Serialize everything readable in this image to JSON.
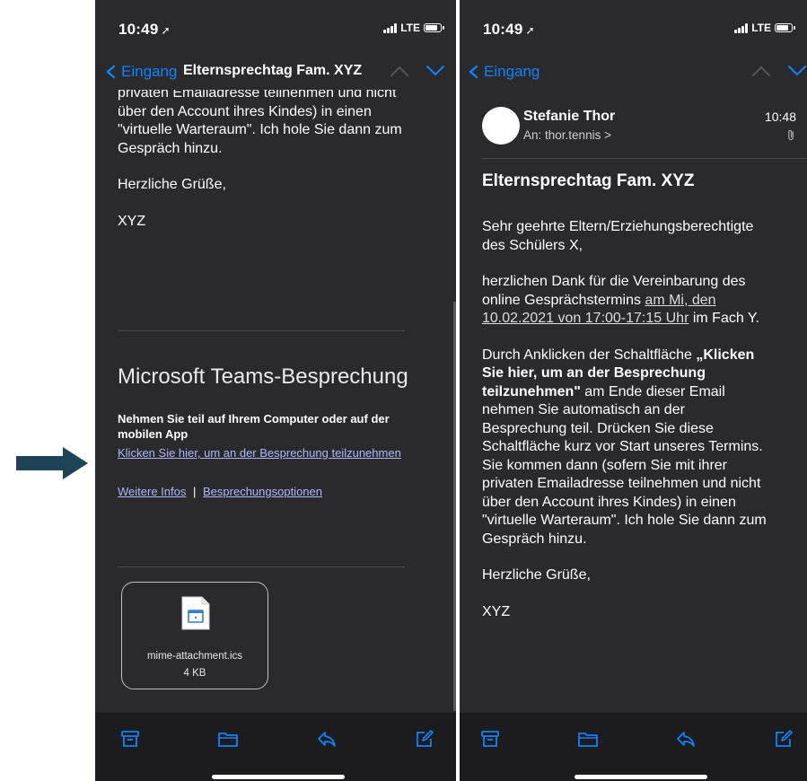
{
  "colors": {
    "accent": "#0a84ff",
    "background": "#2a2a2c",
    "toolbar": "#1c1c1e",
    "arrow": "#1f4458"
  },
  "status_bar": {
    "time": "10:49",
    "network": "LTE"
  },
  "left": {
    "back_label": "Eingang",
    "title": "Elternsprechtag Fam. XYZ",
    "body_lines": [
      "privaten Emailadresse teilnehmen und nicht",
      "über den Account ihres Kindes) in einen",
      "\"virtuelle Warteraum\". Ich hole Sie dann zum",
      "Gespräch hinzu."
    ],
    "greeting": "Herzliche Grüße,",
    "signature": "XYZ",
    "teams": {
      "heading": "Microsoft Teams-Besprechung",
      "join_text_1": "Nehmen Sie teil auf Ihrem Computer oder auf der",
      "join_text_2": "mobilen App",
      "join_link": "Klicken Sie hier, um an der Besprechung teilzunehmen",
      "more_info": "Weitere Infos",
      "divider": "|",
      "options": "Besprechungsoptionen"
    },
    "attachment": {
      "name": "mime-attachment.ics",
      "size": "4 KB"
    }
  },
  "right": {
    "back_label": "Eingang",
    "sender": "Stefanie Thor",
    "to_label": "An:",
    "recipient": "thor.tennis >",
    "time": "10:48",
    "subject": "Elternsprechtag Fam. XYZ",
    "salutation": [
      "Sehr geehrte Eltern/Erziehungsberechtigte",
      "des Schülers X,"
    ],
    "para2_lines": [
      "herzlichen Dank für die Vereinbarung des"
    ],
    "para2_line2_pre": "online Gesprächstermins ",
    "para2_line2_link": "am Mi, den",
    "para2_line3_link": "10.02.2021 von 17:00-17:15 Uhr",
    "para2_line3_post": " im Fach Y.",
    "para3_l1_pre": "Durch Anklicken der Schaltfläche ",
    "para3_l1_bold": "„Klicken",
    "para3_l2_bold": "Sie hier, um an der Besprechung",
    "para3_l3_bold": "teilzunehmen\"",
    "para3_l3_post": " am Ende dieser Email",
    "para3_rest": [
      "nehmen Sie automatisch an der",
      "Besprechung teil. Drücken Sie diese",
      "Schaltfläche kurz vor Start unseres Termins.",
      "Sie kommen dann (sofern Sie mit ihrer",
      "privaten Emailadresse teilnehmen und nicht",
      "über den Account ihres Kindes) in einen",
      "\"virtuelle Warteraum\". Ich hole Sie dann zum",
      "Gespräch hinzu."
    ],
    "greeting": "Herzliche Grüße,",
    "signature": "XYZ"
  },
  "icons": {
    "archive": "archive-icon",
    "folder": "folder-icon",
    "reply": "reply-icon",
    "compose": "compose-icon"
  }
}
